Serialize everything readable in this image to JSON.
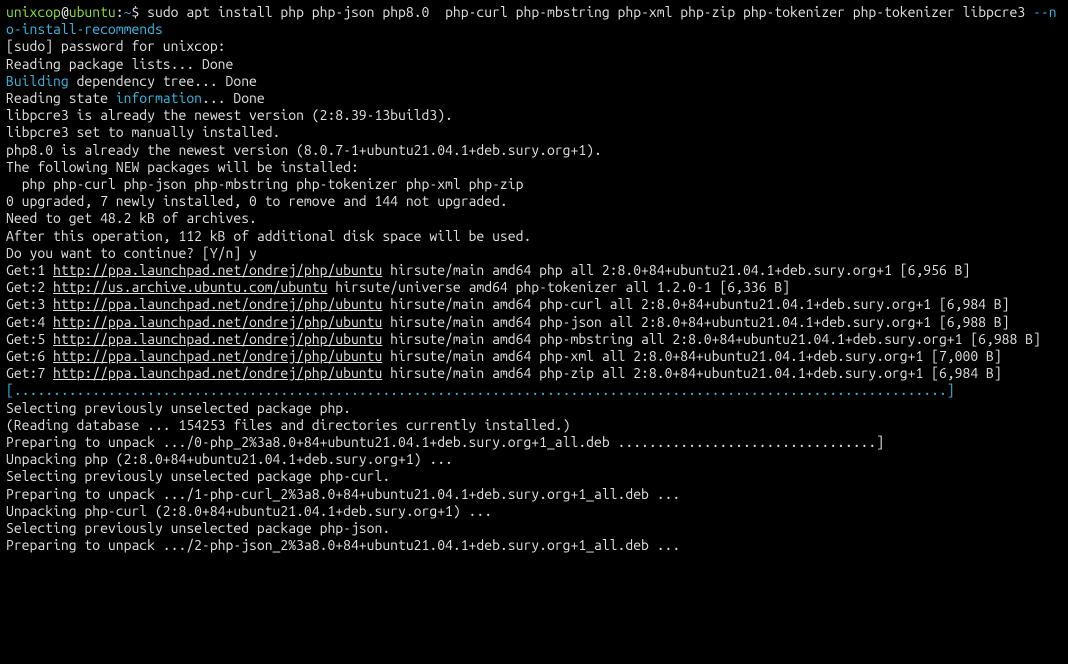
{
  "prompt": {
    "user": "unixcop",
    "host": "ubuntu",
    "path": "~",
    "symbol": "$"
  },
  "command": {
    "base": "sudo apt install php php-json php8.0  php-curl php-mbstring php-xml php-zip php-tokenizer php-tokenizer libpcre3 ",
    "option": "--no-install-recommends"
  },
  "lines": {
    "sudo_pw": "[sudo] password for unixcop:",
    "read_pkg": "Reading package lists... Done",
    "building": "Building",
    "dep_tree": " dependency tree... Done",
    "read_state": "Reading state ",
    "information": "information",
    "read_state_tail": "... Done",
    "libpcre_ver": "libpcre3 is already the newest version (2:8.39-13build3).",
    "libpcre_manual": "libpcre3 set to manually installed.",
    "php8_ver": "php8.0 is already the newest version (8.0.7-1+ubuntu21.04.1+deb.sury.org+1).",
    "new_pkgs_hdr": "The following NEW packages will be installed:",
    "new_pkgs_list": "  php php-curl php-json php-mbstring php-tokenizer php-xml php-zip",
    "upgrade_summary": "0 upgraded, 7 newly installed, 0 to remove and 144 not upgraded.",
    "need_get": "Need to get 48.2 kB of archives.",
    "after_op": "After this operation, 112 kB of additional disk space will be used.",
    "continue_q": "Do you want to continue? [Y/n] y",
    "get1_pre": "Get:1 ",
    "get1_url": "http://ppa.launchpad.net/ondrej/php/ubuntu",
    "get1_post": " hirsute/main amd64 php all 2:8.0+84+ubuntu21.04.1+deb.sury.org+1 [6,956 B]",
    "get2_pre": "Get:2 ",
    "get2_url": "http://us.archive.ubuntu.com/ubuntu",
    "get2_post": " hirsute/universe amd64 php-tokenizer all 1.2.0-1 [6,336 B]",
    "get3_pre": "Get:3 ",
    "get3_url": "http://ppa.launchpad.net/ondrej/php/ubuntu",
    "get3_post": " hirsute/main amd64 php-curl all 2:8.0+84+ubuntu21.04.1+deb.sury.org+1 [6,984 B]",
    "get4_pre": "Get:4 ",
    "get4_url": "http://ppa.launchpad.net/ondrej/php/ubuntu",
    "get4_post": " hirsute/main amd64 php-json all 2:8.0+84+ubuntu21.04.1+deb.sury.org+1 [6,988 B]",
    "get5_pre": "Get:5 ",
    "get5_url": "http://ppa.launchpad.net/ondrej/php/ubuntu",
    "get5_post": " hirsute/main amd64 php-mbstring all 2:8.0+84+ubuntu21.04.1+deb.sury.org+1 [6,988 B]",
    "get6_pre": "Get:6 ",
    "get6_url": "http://ppa.launchpad.net/ondrej/php/ubuntu",
    "get6_post": " hirsute/main amd64 php-xml all 2:8.0+84+ubuntu21.04.1+deb.sury.org+1 [7,000 B]",
    "get7_pre": "Get:7 ",
    "get7_url": "http://ppa.launchpad.net/ondrej/php/ubuntu",
    "get7_post": " hirsute/main amd64 php-zip all 2:8.0+84+ubuntu21.04.1+deb.sury.org+1 [6,984 B]",
    "progress_bar": "[.......................................................................................................................]",
    "sel_php": "Selecting previously unselected package php.",
    "read_db": "(Reading database ... 154253 files and directories currently installed.)",
    "prep_php": "Preparing to unpack .../0-php_2%3a8.0+84+ubuntu21.04.1+deb.sury.org+1_all.deb .................................]",
    "unpack_php": "Unpacking php (2:8.0+84+ubuntu21.04.1+deb.sury.org+1) ...",
    "sel_phpcurl": "Selecting previously unselected package php-curl.",
    "prep_phpcurl": "Preparing to unpack .../1-php-curl_2%3a8.0+84+ubuntu21.04.1+deb.sury.org+1_all.deb ...",
    "unpack_phpcurl": "Unpacking php-curl (2:8.0+84+ubuntu21.04.1+deb.sury.org+1) ...",
    "sel_phpjson": "Selecting previously unselected package php-json.",
    "prep_phpjson": "Preparing to unpack .../2-php-json_2%3a8.0+84+ubuntu21.04.1+deb.sury.org+1_all.deb ..."
  }
}
